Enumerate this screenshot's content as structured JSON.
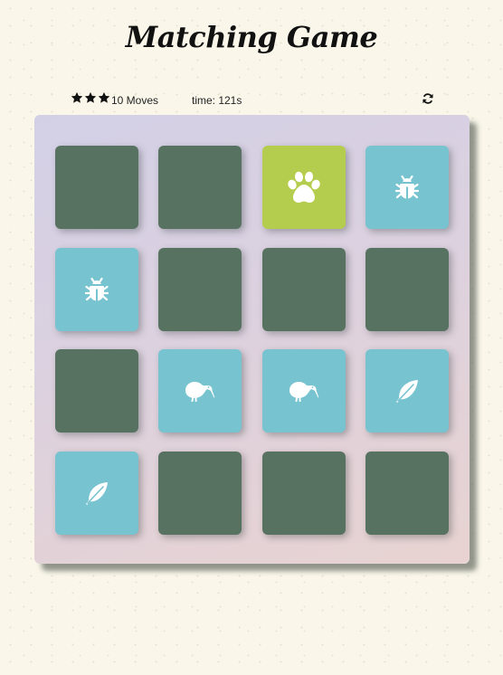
{
  "title": "Matching Game",
  "score": {
    "stars": 3,
    "moves_label": "10 Moves",
    "timer_label": "time: 121s"
  },
  "restart_icon": "refresh-icon",
  "colors": {
    "closed": "#587261",
    "open": "#77c3d0",
    "match": "#b5cd4e"
  },
  "cards": [
    {
      "icon": "hidden",
      "state": "closed"
    },
    {
      "icon": "hidden",
      "state": "closed"
    },
    {
      "icon": "paw-icon",
      "state": "match"
    },
    {
      "icon": "bug-icon",
      "state": "open"
    },
    {
      "icon": "bug-icon",
      "state": "open"
    },
    {
      "icon": "hidden",
      "state": "closed"
    },
    {
      "icon": "hidden",
      "state": "closed"
    },
    {
      "icon": "hidden",
      "state": "closed"
    },
    {
      "icon": "hidden",
      "state": "closed"
    },
    {
      "icon": "kiwi-bird-icon",
      "state": "open"
    },
    {
      "icon": "kiwi-bird-icon",
      "state": "open"
    },
    {
      "icon": "feather-icon",
      "state": "open"
    },
    {
      "icon": "feather-icon",
      "state": "open"
    },
    {
      "icon": "hidden",
      "state": "closed"
    },
    {
      "icon": "hidden",
      "state": "closed"
    },
    {
      "icon": "hidden",
      "state": "closed"
    }
  ]
}
